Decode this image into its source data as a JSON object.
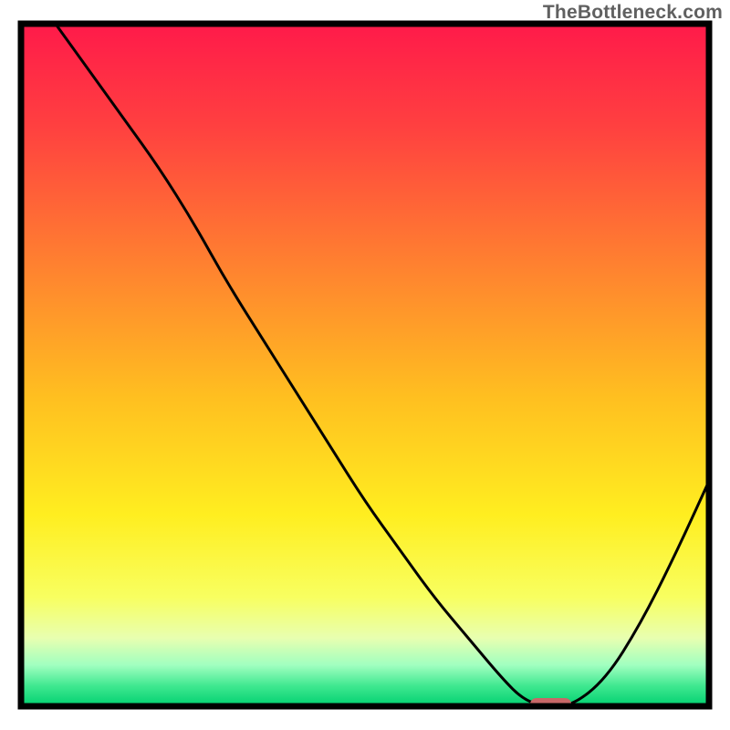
{
  "attribution": "TheBottleneck.com",
  "chart_data": {
    "type": "line",
    "title": "",
    "xlabel": "",
    "ylabel": "",
    "xlim": [
      0,
      100
    ],
    "ylim": [
      0,
      100
    ],
    "grid": false,
    "legend": false,
    "curve": {
      "name": "bottleneck-curve",
      "x": [
        5,
        10,
        15,
        20,
        25,
        30,
        35,
        40,
        45,
        50,
        55,
        60,
        65,
        70,
        73,
        76,
        80,
        85,
        90,
        95,
        100
      ],
      "y": [
        100,
        93,
        86,
        79,
        71,
        62,
        54,
        46,
        38,
        30,
        23,
        16,
        10,
        4,
        1,
        0,
        0,
        4,
        12,
        22,
        33
      ]
    },
    "marker": {
      "name": "optimal-marker",
      "x_range": [
        74,
        80
      ],
      "y": 0,
      "color": "#c86868"
    },
    "gradient_stops": [
      {
        "pos": 0.0,
        "color": "#ff1a4a"
      },
      {
        "pos": 0.15,
        "color": "#ff4040"
      },
      {
        "pos": 0.35,
        "color": "#ff8030"
      },
      {
        "pos": 0.55,
        "color": "#ffc020"
      },
      {
        "pos": 0.72,
        "color": "#ffee20"
      },
      {
        "pos": 0.84,
        "color": "#f8ff60"
      },
      {
        "pos": 0.9,
        "color": "#e8ffb0"
      },
      {
        "pos": 0.94,
        "color": "#a0ffc0"
      },
      {
        "pos": 0.97,
        "color": "#40e890"
      },
      {
        "pos": 1.0,
        "color": "#00d070"
      }
    ],
    "frame": {
      "border_color": "#000000",
      "border_width": 7
    }
  }
}
